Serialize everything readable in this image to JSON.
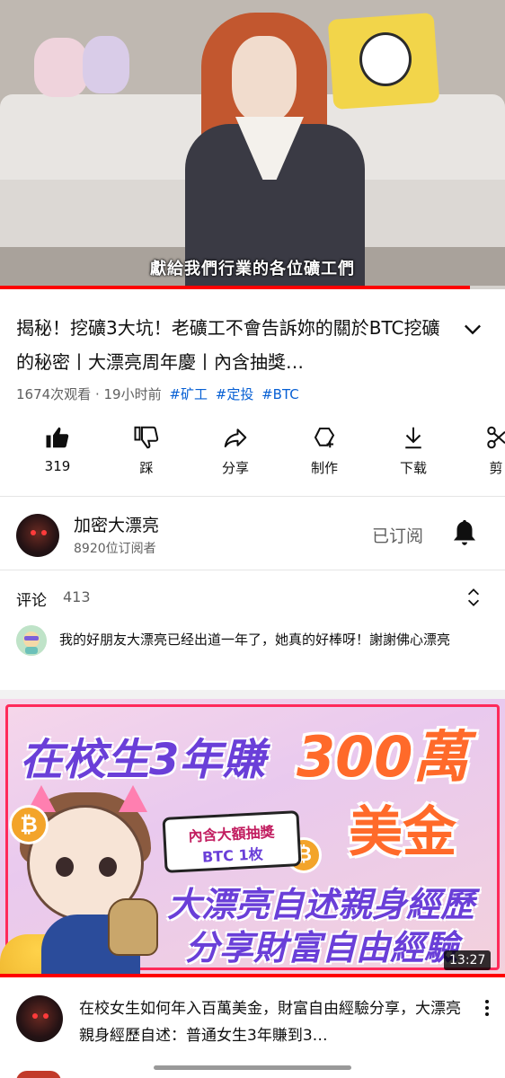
{
  "player": {
    "subtitle": "獻給我們行業的各位礦工們",
    "progress_fraction": 0.93,
    "accent": "#ff0000"
  },
  "video": {
    "title": "揭秘！挖礦3大坑！老礦工不會告訴妳的關於BTC挖礦的秘密丨大漂亮周年慶丨內含抽獎…",
    "views": "1674次观看",
    "age": "19小时前",
    "tags": [
      "#矿工",
      "#定投",
      "#BTC"
    ]
  },
  "actions": [
    {
      "icon": "thumbs-up-icon",
      "label": "319"
    },
    {
      "icon": "thumbs-down-icon",
      "label": "踩"
    },
    {
      "icon": "share-icon",
      "label": "分享"
    },
    {
      "icon": "create-icon",
      "label": "制作"
    },
    {
      "icon": "download-icon",
      "label": "下载"
    },
    {
      "icon": "clip-icon",
      "label": "剪"
    }
  ],
  "channel": {
    "name": "加密大漂亮",
    "subscribers": "8920位订阅者",
    "subscribe_state": "已订阅"
  },
  "comments": {
    "title": "评论",
    "count": "413",
    "top_comment": "我的好朋友大漂亮已经出道一年了，她真的好棒呀！謝謝佛心漂亮"
  },
  "next_video": {
    "thumbnail": {
      "line1a": "在校生3年賺",
      "line1b": "300萬",
      "line2": "美金",
      "box_line1": "內含大額抽獎",
      "box_line2": "BTC 1枚",
      "line3": "大漂亮自述親身經歷",
      "line4": "分享財富自由經驗"
    },
    "duration": "13:27",
    "title": "在校女生如何年入百萬美金，財富自由經驗分享，大漂亮親身經歷自述：普通女生3年賺到3…"
  }
}
